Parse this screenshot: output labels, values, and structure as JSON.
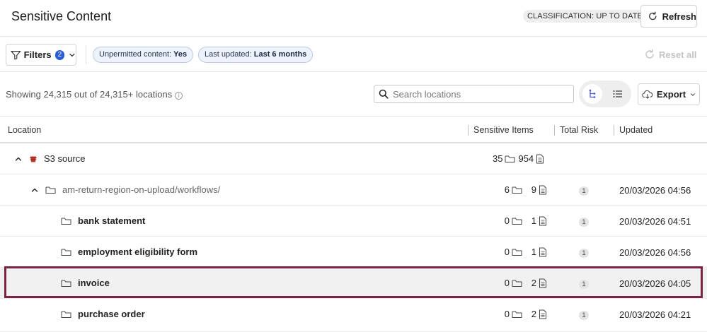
{
  "header": {
    "title": "Sensitive Content",
    "classification_badge": "CLASSIFICATION: UP TO DATE",
    "refresh_label": "Refresh"
  },
  "filterbar": {
    "filters_label": "Filters",
    "filters_count": "2",
    "chips": [
      {
        "label": "Unpermitted content: ",
        "value": "Yes"
      },
      {
        "label": "Last updated: ",
        "value": "Last 6 months"
      }
    ],
    "reset_label": "Reset all"
  },
  "toolbar": {
    "showing_text": "Showing 24,315 out of 24,315+ locations",
    "search_placeholder": "Search locations",
    "export_label": "Export"
  },
  "table": {
    "columns": [
      "Location",
      "Sensitive Items",
      "Total Risk",
      "Updated"
    ],
    "rows": [
      {
        "name": "S3 source",
        "folders": "35",
        "files": "954",
        "risk": "",
        "updated": ""
      },
      {
        "name": "am-return-region-on-upload/workflows/",
        "folders": "6",
        "files": "9",
        "risk": "1",
        "updated": "20/03/2026 04:56"
      },
      {
        "name": "bank statement",
        "folders": "0",
        "files": "1",
        "risk": "1",
        "updated": "20/03/2026 04:51"
      },
      {
        "name": "employment eligibility form",
        "folders": "0",
        "files": "1",
        "risk": "1",
        "updated": "20/03/2026 04:56"
      },
      {
        "name": "invoice",
        "folders": "0",
        "files": "2",
        "risk": "1",
        "updated": "20/03/2026 04:05"
      },
      {
        "name": "purchase order",
        "folders": "0",
        "files": "2",
        "risk": "1",
        "updated": "20/03/2026 04:21"
      }
    ],
    "selected_row": "invoice"
  },
  "colors": {
    "accent_blue": "#2a5bd7",
    "chip_background": "#eef3fb",
    "selection_outline": "#7b2344",
    "s3_icon": "#c0392b"
  },
  "icons": [
    "refresh-icon",
    "filter-icon",
    "chevron-down-icon",
    "reset-icon",
    "info-icon",
    "search-icon",
    "tree-view-icon",
    "list-view-icon",
    "cloud-download-icon",
    "chevron-up-icon",
    "s3-bucket-icon",
    "folder-icon",
    "file-icon"
  ]
}
